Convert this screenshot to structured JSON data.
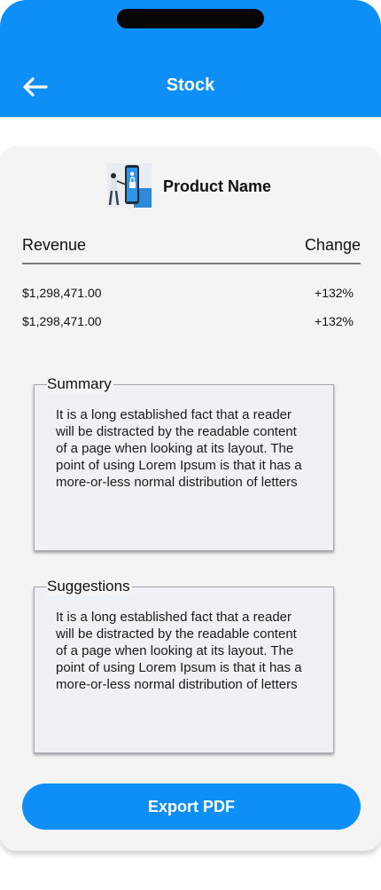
{
  "header": {
    "title": "Stock",
    "back_icon": "arrow-left-icon"
  },
  "product": {
    "name": "Product Name",
    "thumbnail_icon": "phone-lock-illustration"
  },
  "table": {
    "columns": [
      "Revenue",
      "Change"
    ],
    "rows": [
      {
        "revenue": "$1,298,471.00",
        "change": "+132%"
      },
      {
        "revenue": "$1,298,471.00",
        "change": "+132%"
      }
    ]
  },
  "summary": {
    "title": "Summary",
    "text": "It is a long established fact that a reader will be distracted by the readable content of a page when looking at its layout. The point of using Lorem Ipsum is that it has a more-or-less normal distribution of letters"
  },
  "suggestions": {
    "title": "Suggestions",
    "text": "It is a long established fact that a reader will be distracted by the readable content of a page when looking at its layout. The point of using Lorem Ipsum is that it has a more-or-less normal distribution of letters"
  },
  "actions": {
    "export_label": "Export PDF"
  },
  "colors": {
    "accent": "#0d8ff7",
    "card_bg": "#f4f4f4",
    "panel_bg": "#eef2f7"
  }
}
